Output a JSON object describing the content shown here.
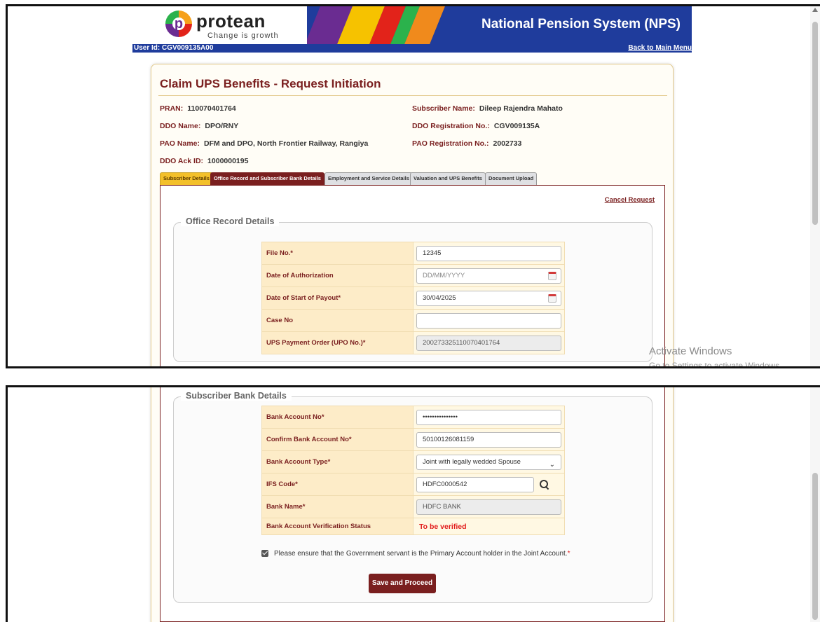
{
  "header": {
    "brand": "protean",
    "tagline": "Change is growth",
    "system_title": "National Pension System (NPS)",
    "user_id": "User Id: CGV009135A00",
    "back_link": "Back to Main Menu"
  },
  "page": {
    "title": "Claim UPS Benefits - Request Initiation"
  },
  "subscriber_info": {
    "pran_label": "PRAN:",
    "pran_value": "110070401764",
    "name_label": "Subscriber Name:",
    "name_value": "Dileep Rajendra Mahato",
    "ddo_name_label": "DDO Name:",
    "ddo_name_value": "DPO/RNY",
    "ddo_reg_label": "DDO Registration No.:",
    "ddo_reg_value": "CGV009135A",
    "pao_name_label": "PAO Name:",
    "pao_name_value": "DFM and DPO, North Frontier Railway, Rangiya",
    "pao_reg_label": "PAO Registration No.:",
    "pao_reg_value": "2002733",
    "ack_label": "DDO Ack ID:",
    "ack_value": "1000000195"
  },
  "tabs": [
    {
      "label": "Subscriber Details"
    },
    {
      "label": "Office Record and Subscriber Bank Details"
    },
    {
      "label": "Employment and Service Details"
    },
    {
      "label": "Valuation and UPS Benefits"
    },
    {
      "label": "Document Upload"
    }
  ],
  "cancel_link": "Cancel Request",
  "office_record": {
    "legend": "Office Record Details",
    "file_no": {
      "label": "File No.*",
      "value": "12345"
    },
    "date_auth": {
      "label": "Date of Authorization",
      "placeholder": "DD/MM/YYYY"
    },
    "date_payout": {
      "label": "Date of Start of Payout*",
      "value": "30/04/2025"
    },
    "case_no": {
      "label": "Case No",
      "value": ""
    },
    "upo_no": {
      "label": "UPS Payment Order (UPO No.)*",
      "value": "2002733251100704017​64"
    }
  },
  "bank": {
    "legend": "Subscriber Bank Details",
    "account_no": {
      "label": "Bank Account No*",
      "value": "•••••••••••••••"
    },
    "confirm_account": {
      "label": "Confirm Bank Account No*",
      "value": "50100126081159"
    },
    "account_type": {
      "label": "Bank Account Type*",
      "value": "Joint with legally wedded Spouse"
    },
    "ifsc": {
      "label": "IFS Code*",
      "value": "HDFC0000542"
    },
    "bank_name": {
      "label": "Bank Name*",
      "value": "HDFC BANK"
    },
    "verification": {
      "label": "Bank Account Verification Status",
      "value": "To be verified"
    }
  },
  "consent_text": "Please ensure that the Government servant is the Primary Account holder in the Joint Account.",
  "consent_required_mark": "*",
  "save_button": "Save and Proceed",
  "watermark": {
    "line1": "Activate Windows",
    "line2": "Go to Settings to activate Windows."
  },
  "colors": {
    "maroon": "#7a1f1f",
    "nav_blue": "#1f3c9c",
    "tab_yellow": "#f3c02a",
    "status_red": "#e21c1c"
  }
}
